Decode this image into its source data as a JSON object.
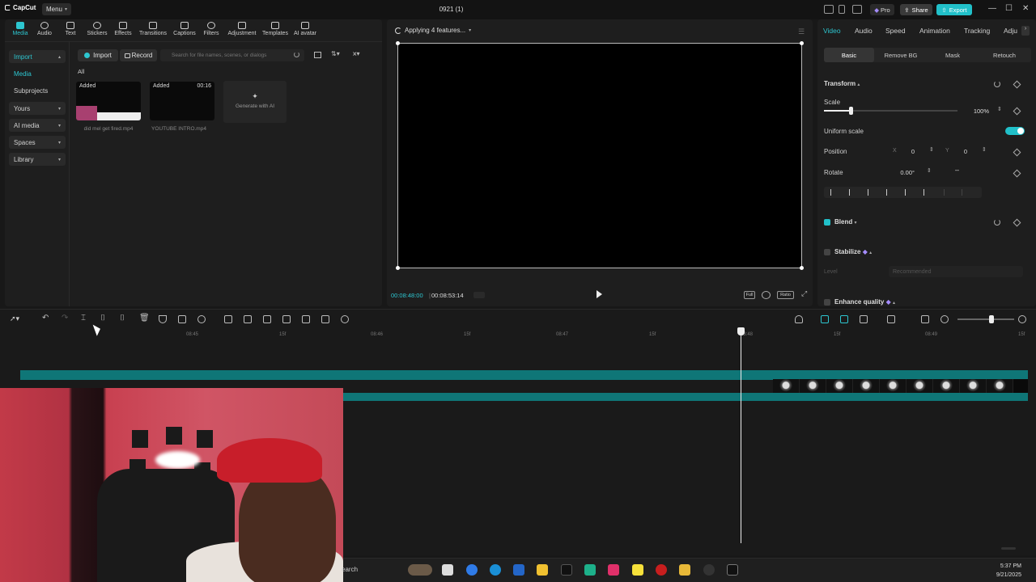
{
  "titlebar": {
    "logo": "CapCut",
    "menu_label": "Menu",
    "project_title": "0921 (1)",
    "pro_label": "Pro",
    "share_label": "Share",
    "export_label": "Export"
  },
  "tools": [
    {
      "label": "Media",
      "icon": "media-icon"
    },
    {
      "label": "Audio",
      "icon": "audio-icon"
    },
    {
      "label": "Text",
      "icon": "text-icon"
    },
    {
      "label": "Stickers",
      "icon": "sticker-icon"
    },
    {
      "label": "Effects",
      "icon": "effects-icon"
    },
    {
      "label": "Transitions",
      "icon": "transitions-icon"
    },
    {
      "label": "Captions",
      "icon": "captions-icon"
    },
    {
      "label": "Filters",
      "icon": "filters-icon"
    },
    {
      "label": "Adjustment",
      "icon": "adjustment-icon"
    },
    {
      "label": "Templates",
      "icon": "templates-icon"
    },
    {
      "label": "AI avatar",
      "icon": "ai-avatar-icon"
    }
  ],
  "sidebar": {
    "items": [
      {
        "label": "Import"
      },
      {
        "label": "Media"
      },
      {
        "label": "Subprojects"
      },
      {
        "label": "Yours"
      },
      {
        "label": "AI media"
      },
      {
        "label": "Spaces"
      },
      {
        "label": "Library"
      }
    ]
  },
  "media": {
    "import_label": "Import",
    "record_label": "Record",
    "search_placeholder": "Search for file names, scenes, or dialogs",
    "filter_label": "All",
    "items": [
      {
        "badge": "Added",
        "duration": "",
        "name": "did mel get fired.mp4"
      },
      {
        "badge": "Added",
        "duration": "00:16",
        "name": "YOUTUBE INTRO.mp4"
      }
    ],
    "generate_label": "Generate with AI"
  },
  "player": {
    "status": "Applying 4 features...",
    "current_time": "00:08:48:00",
    "total_time": "00:08:53:14",
    "full_label": "Full",
    "ratio_label": "Ratio"
  },
  "inspector": {
    "tabs": [
      "Video",
      "Audio",
      "Speed",
      "Animation",
      "Tracking",
      "Adju"
    ],
    "subtabs": [
      "Basic",
      "Remove BG",
      "Mask",
      "Retouch"
    ],
    "transform_title": "Transform",
    "scale_label": "Scale",
    "scale_value": "100%",
    "scale_fraction": 0.2,
    "uniform_scale_label": "Uniform scale",
    "position_label": "Position",
    "pos_x_label": "X",
    "pos_x_value": "0",
    "pos_y_label": "Y",
    "pos_y_value": "0",
    "rotate_label": "Rotate",
    "rotate_value": "0.00°",
    "blend_label": "Blend",
    "stabilize_label": "Stabilize",
    "level_label": "Level",
    "level_value": "Recommended",
    "enhance_label": "Enhance quality"
  },
  "timeline": {
    "ruler": [
      "08:45",
      "15f",
      "08:46",
      "15f",
      "08:47",
      "15f",
      "08:48",
      "15f",
      "08:49",
      "15f"
    ]
  },
  "taskbar": {
    "search_label": "earch",
    "time": "5:37 PM",
    "date": "9/21/2025"
  },
  "colors": {
    "accent": "#21c0c9",
    "track": "#0f7677"
  }
}
